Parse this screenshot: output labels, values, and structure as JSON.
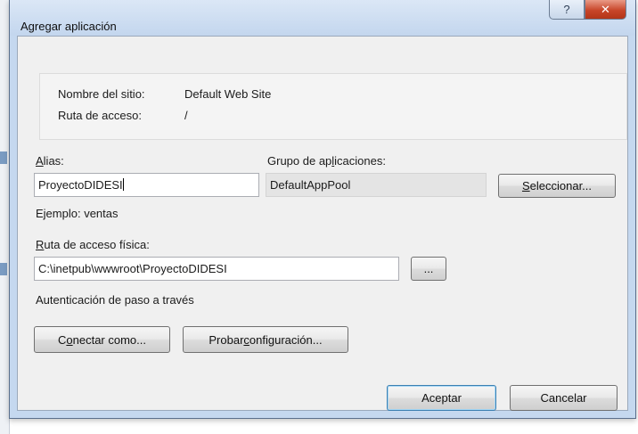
{
  "window": {
    "title": "Agregar aplicación"
  },
  "titlebar": {
    "help_glyph": "?",
    "close_glyph": "✕"
  },
  "site_info": {
    "site_name_label": "Nombre del sitio:",
    "site_name_value": "Default Web Site",
    "path_label": "Ruta de acceso:",
    "path_value": "/"
  },
  "alias": {
    "label_first": "A",
    "label_rest": "lias:",
    "value": "ProyectoDIDESI",
    "example": "Ejemplo: ventas"
  },
  "app_pool": {
    "label_before": "Grupo de ap",
    "label_underlined": "l",
    "label_after": "icaciones:",
    "value": "DefaultAppPool",
    "select_button_first": "S",
    "select_button_rest": "eleccionar..."
  },
  "physical_path": {
    "label_first": "R",
    "label_rest": "uta de acceso física:",
    "value": "C:\\inetpub\\wwwroot\\ProyectoDIDESI",
    "browse_button": "..."
  },
  "auth": {
    "text": "Autenticación de paso a través"
  },
  "buttons": {
    "connect_as_before": "C",
    "connect_as_underlined": "o",
    "connect_as_after": "nectar como...",
    "test_config_before": "Probar ",
    "test_config_underlined": "c",
    "test_config_after": "onfiguración...",
    "ok": "Aceptar",
    "cancel": "Cancelar"
  }
}
